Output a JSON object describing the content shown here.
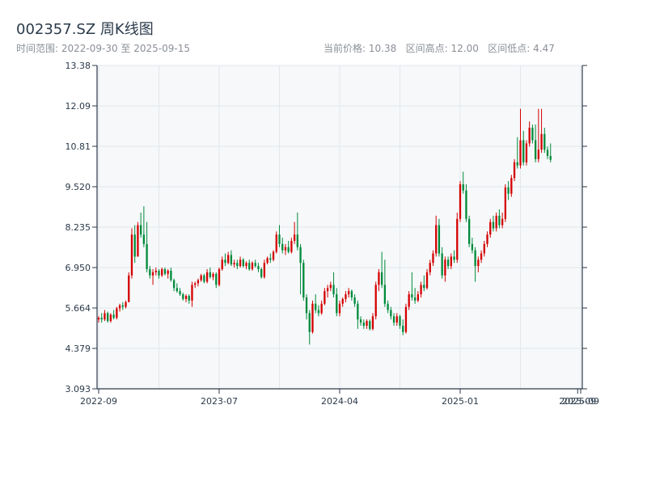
{
  "header": {
    "title": "002357.SZ 周K线图",
    "range_text": "时间范围: 2022-09-30 至 2025-09-15",
    "stats_text": "当前价格: 10.38   区间高点: 12.00   区间低点: 4.47"
  },
  "colors": {
    "up": "#d40000",
    "down": "#008a3a",
    "plot_bg": "#f6f8fa",
    "grid": "#e3e7ec",
    "axis": "#2b3a4a"
  },
  "chart_data": {
    "type": "candlestick",
    "title": "002357.SZ 周K线图",
    "xlabel": "",
    "ylabel": "",
    "ylim": [
      3.093,
      13.38
    ],
    "yticks": [
      "13.38",
      "12.09",
      "10.81",
      "9.520",
      "8.235",
      "6.950",
      "5.664",
      "4.379",
      "3.093"
    ],
    "xticks": [
      {
        "label": "2022-09",
        "index": 0
      },
      {
        "label": "2023-07",
        "index": 40
      },
      {
        "label": "2024-04",
        "index": 80
      },
      {
        "label": "2025-01",
        "index": 120
      },
      {
        "label": "2025-09",
        "index": 159
      },
      {
        "label": "2025-09",
        "index": 160
      }
    ],
    "grid": true,
    "x_count": 161,
    "candles": [
      [
        5.3,
        5.4,
        5.2,
        5.35
      ],
      [
        5.35,
        5.5,
        5.2,
        5.3
      ],
      [
        5.3,
        5.6,
        5.25,
        5.5
      ],
      [
        5.5,
        5.55,
        5.2,
        5.25
      ],
      [
        5.25,
        5.5,
        5.2,
        5.45
      ],
      [
        5.45,
        5.6,
        5.3,
        5.35
      ],
      [
        5.35,
        5.7,
        5.3,
        5.65
      ],
      [
        5.65,
        5.8,
        5.55,
        5.75
      ],
      [
        5.75,
        5.85,
        5.6,
        5.7
      ],
      [
        5.7,
        5.9,
        5.65,
        5.85
      ],
      [
        5.85,
        6.8,
        5.85,
        6.7
      ],
      [
        6.7,
        8.2,
        6.6,
        8.0
      ],
      [
        8.0,
        8.3,
        7.1,
        7.3
      ],
      [
        7.3,
        8.4,
        7.3,
        8.3
      ],
      [
        8.3,
        8.7,
        7.9,
        8.0
      ],
      [
        8.0,
        8.9,
        7.6,
        7.7
      ],
      [
        7.7,
        8.4,
        6.8,
        6.9
      ],
      [
        6.9,
        7.0,
        6.6,
        6.7
      ],
      [
        6.7,
        6.9,
        6.4,
        6.8
      ],
      [
        6.8,
        6.95,
        6.7,
        6.85
      ],
      [
        6.85,
        6.9,
        6.6,
        6.7
      ],
      [
        6.7,
        6.95,
        6.65,
        6.9
      ],
      [
        6.9,
        6.95,
        6.7,
        6.75
      ],
      [
        6.75,
        6.9,
        6.6,
        6.85
      ],
      [
        6.85,
        6.95,
        6.5,
        6.55
      ],
      [
        6.55,
        6.6,
        6.2,
        6.3
      ],
      [
        6.3,
        6.45,
        6.15,
        6.2
      ],
      [
        6.2,
        6.3,
        6.05,
        6.1
      ],
      [
        6.1,
        6.15,
        5.9,
        5.95
      ],
      [
        5.95,
        6.1,
        5.85,
        6.05
      ],
      [
        6.05,
        6.1,
        5.8,
        5.9
      ],
      [
        5.9,
        6.5,
        5.7,
        6.4
      ],
      [
        6.4,
        6.5,
        6.3,
        6.45
      ],
      [
        6.45,
        6.6,
        6.35,
        6.55
      ],
      [
        6.55,
        6.75,
        6.5,
        6.7
      ],
      [
        6.7,
        6.75,
        6.45,
        6.5
      ],
      [
        6.5,
        6.9,
        6.45,
        6.8
      ],
      [
        6.8,
        6.95,
        6.6,
        6.65
      ],
      [
        6.65,
        6.8,
        6.55,
        6.75
      ],
      [
        6.75,
        6.8,
        6.3,
        6.4
      ],
      [
        6.4,
        6.95,
        6.35,
        6.9
      ],
      [
        6.9,
        7.3,
        6.85,
        7.2
      ],
      [
        7.2,
        7.4,
        7.0,
        7.1
      ],
      [
        7.1,
        7.45,
        7.05,
        7.35
      ],
      [
        7.35,
        7.5,
        7.0,
        7.05
      ],
      [
        7.05,
        7.2,
        6.95,
        7.1
      ],
      [
        7.1,
        7.2,
        6.9,
        7.0
      ],
      [
        7.0,
        7.3,
        6.95,
        7.2
      ],
      [
        7.2,
        7.25,
        6.95,
        7.0
      ],
      [
        7.0,
        7.15,
        6.9,
        7.1
      ],
      [
        7.1,
        7.2,
        6.85,
        6.9
      ],
      [
        6.9,
        7.15,
        6.85,
        7.1
      ],
      [
        7.1,
        7.2,
        6.95,
        7.0
      ],
      [
        7.0,
        7.1,
        6.8,
        6.9
      ],
      [
        6.9,
        6.95,
        6.6,
        6.65
      ],
      [
        6.65,
        7.2,
        6.6,
        7.1
      ],
      [
        7.1,
        7.3,
        7.05,
        7.25
      ],
      [
        7.25,
        7.4,
        7.1,
        7.2
      ],
      [
        7.2,
        7.5,
        7.15,
        7.45
      ],
      [
        7.45,
        8.1,
        7.4,
        8.0
      ],
      [
        8.0,
        8.3,
        7.6,
        7.7
      ],
      [
        7.7,
        7.9,
        7.4,
        7.5
      ],
      [
        7.5,
        7.7,
        7.35,
        7.6
      ],
      [
        7.6,
        7.8,
        7.4,
        7.45
      ],
      [
        7.45,
        7.9,
        7.4,
        7.8
      ],
      [
        7.8,
        8.4,
        7.7,
        8.0
      ],
      [
        8.0,
        8.7,
        7.5,
        7.6
      ],
      [
        7.6,
        7.7,
        6.1,
        7.1
      ],
      [
        7.1,
        7.2,
        5.9,
        6.0
      ],
      [
        6.0,
        6.1,
        5.3,
        5.5
      ],
      [
        5.5,
        5.6,
        4.5,
        4.9
      ],
      [
        4.9,
        5.9,
        4.85,
        5.8
      ],
      [
        5.8,
        6.1,
        5.5,
        5.6
      ],
      [
        5.6,
        5.75,
        5.4,
        5.5
      ],
      [
        5.5,
        5.9,
        5.45,
        5.8
      ],
      [
        5.8,
        6.3,
        5.75,
        6.2
      ],
      [
        6.2,
        6.4,
        6.0,
        6.3
      ],
      [
        6.3,
        6.5,
        6.2,
        6.4
      ],
      [
        6.4,
        6.8,
        6.0,
        6.1
      ],
      [
        6.1,
        6.3,
        5.4,
        5.5
      ],
      [
        5.5,
        5.9,
        5.4,
        5.8
      ],
      [
        5.8,
        6.0,
        5.7,
        5.95
      ],
      [
        5.95,
        6.2,
        5.85,
        6.1
      ],
      [
        6.1,
        6.3,
        6.0,
        6.2
      ],
      [
        6.2,
        6.25,
        5.9,
        6.0
      ],
      [
        6.0,
        6.1,
        5.7,
        5.8
      ],
      [
        5.8,
        5.9,
        5.0,
        5.3
      ],
      [
        5.3,
        5.4,
        5.1,
        5.2
      ],
      [
        5.2,
        5.3,
        5.0,
        5.1
      ],
      [
        5.1,
        5.3,
        5.0,
        5.25
      ],
      [
        5.25,
        5.3,
        4.95,
        5.0
      ],
      [
        5.0,
        5.5,
        4.95,
        5.4
      ],
      [
        5.4,
        6.5,
        5.3,
        6.4
      ],
      [
        6.4,
        6.9,
        6.2,
        6.8
      ],
      [
        6.8,
        7.45,
        6.3,
        6.4
      ],
      [
        6.4,
        7.2,
        5.7,
        5.8
      ],
      [
        5.8,
        5.9,
        5.5,
        5.6
      ],
      [
        5.6,
        5.7,
        5.3,
        5.4
      ],
      [
        5.4,
        5.5,
        5.1,
        5.2
      ],
      [
        5.2,
        5.5,
        5.1,
        5.4
      ],
      [
        5.4,
        5.45,
        5.0,
        5.1
      ],
      [
        5.1,
        5.3,
        4.8,
        4.9
      ],
      [
        4.9,
        5.8,
        4.85,
        5.7
      ],
      [
        5.7,
        6.2,
        5.6,
        6.1
      ],
      [
        6.1,
        6.8,
        5.9,
        6.0
      ],
      [
        6.0,
        6.3,
        5.8,
        5.9
      ],
      [
        5.9,
        6.2,
        5.85,
        6.1
      ],
      [
        6.1,
        6.5,
        6.0,
        6.4
      ],
      [
        6.4,
        6.7,
        6.2,
        6.3
      ],
      [
        6.3,
        6.9,
        6.25,
        6.8
      ],
      [
        6.8,
        7.2,
        6.7,
        7.1
      ],
      [
        7.1,
        7.5,
        7.0,
        7.4
      ],
      [
        7.4,
        8.6,
        7.3,
        8.3
      ],
      [
        8.3,
        8.5,
        7.3,
        7.4
      ],
      [
        7.4,
        7.6,
        6.6,
        6.7
      ],
      [
        6.7,
        7.3,
        6.5,
        7.2
      ],
      [
        7.2,
        7.3,
        6.9,
        7.0
      ],
      [
        7.0,
        7.4,
        6.9,
        7.3
      ],
      [
        7.3,
        7.5,
        7.1,
        7.2
      ],
      [
        7.2,
        8.7,
        7.1,
        8.5
      ],
      [
        8.5,
        9.7,
        8.4,
        9.6
      ],
      [
        9.6,
        10.0,
        9.3,
        9.4
      ],
      [
        9.4,
        9.6,
        8.4,
        8.5
      ],
      [
        8.5,
        8.6,
        7.6,
        7.7
      ],
      [
        7.7,
        7.9,
        7.4,
        7.5
      ],
      [
        7.5,
        7.6,
        6.5,
        7.0
      ],
      [
        7.0,
        7.3,
        6.8,
        7.2
      ],
      [
        7.2,
        7.5,
        7.1,
        7.4
      ],
      [
        7.4,
        7.8,
        7.3,
        7.7
      ],
      [
        7.7,
        8.1,
        7.6,
        8.0
      ],
      [
        8.0,
        8.5,
        7.9,
        8.4
      ],
      [
        8.4,
        8.6,
        8.1,
        8.2
      ],
      [
        8.2,
        8.7,
        8.1,
        8.6
      ],
      [
        8.6,
        8.8,
        8.2,
        8.3
      ],
      [
        8.3,
        8.7,
        8.2,
        8.5
      ],
      [
        8.5,
        9.6,
        8.4,
        9.5
      ],
      [
        9.5,
        9.7,
        9.1,
        9.3
      ],
      [
        9.3,
        9.9,
        9.2,
        9.8
      ],
      [
        9.8,
        10.4,
        9.7,
        10.3
      ],
      [
        10.3,
        11.1,
        10.1,
        10.2
      ],
      [
        10.2,
        12.0,
        10.1,
        11.0
      ],
      [
        11.0,
        11.3,
        10.2,
        10.3
      ],
      [
        10.3,
        11.0,
        10.2,
        10.9
      ],
      [
        10.9,
        11.6,
        10.8,
        11.4
      ],
      [
        11.4,
        11.5,
        10.9,
        11.0
      ],
      [
        11.0,
        11.5,
        10.3,
        10.4
      ],
      [
        10.4,
        12.0,
        10.3,
        10.7
      ],
      [
        10.7,
        12.0,
        10.6,
        11.2
      ],
      [
        11.2,
        11.4,
        10.6,
        10.7
      ],
      [
        10.7,
        10.8,
        10.4,
        10.5
      ],
      [
        10.5,
        10.9,
        10.3,
        10.38
      ]
    ]
  }
}
